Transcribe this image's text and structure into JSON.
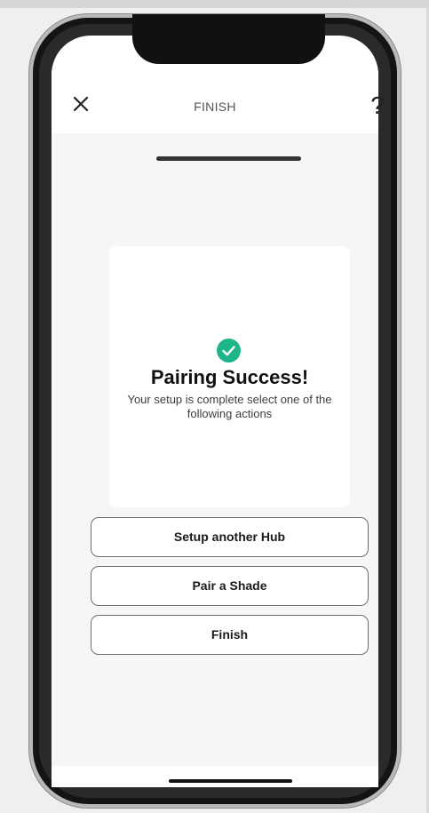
{
  "header": {
    "title": "FINISH",
    "close_icon": "close-icon",
    "help_label": "?"
  },
  "progress": {
    "value": 1.0
  },
  "success_card": {
    "icon": "check-circle-icon",
    "icon_color": "#1fb58a",
    "title": "Pairing Success!",
    "message": "Your setup is complete select one of the following actions"
  },
  "actions": {
    "setup_hub_label": "Setup another Hub",
    "pair_shade_label": "Pair a Shade",
    "finish_label": "Finish"
  }
}
